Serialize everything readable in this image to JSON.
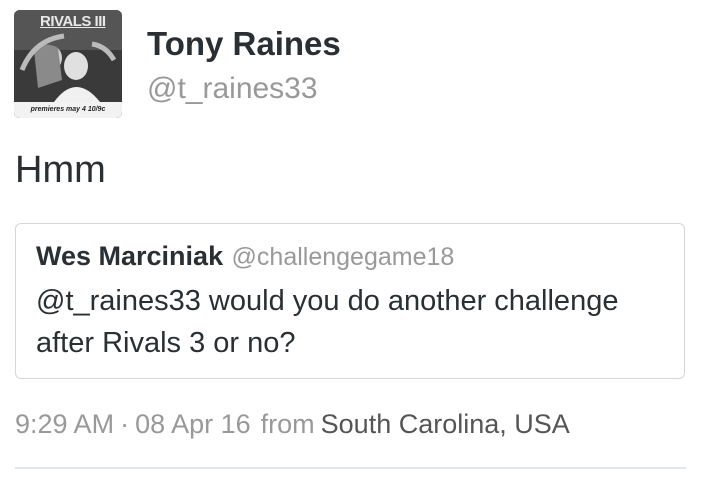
{
  "author": {
    "display_name": "Tony Raines",
    "username": "@t_raines33",
    "avatar": {
      "logo_text": "RIVALS III",
      "caption": "premieres may 4 10/9c"
    }
  },
  "tweet": {
    "text": "Hmm"
  },
  "quoted_tweet": {
    "display_name": "Wes Marciniak",
    "username": "@challengegame18",
    "text": "@t_raines33 would you do another challenge after Rivals 3 or no?"
  },
  "meta": {
    "time": "9:29 AM",
    "separator": "·",
    "date": "08 Apr 16",
    "from_label": "from",
    "location": "South Carolina, USA"
  }
}
